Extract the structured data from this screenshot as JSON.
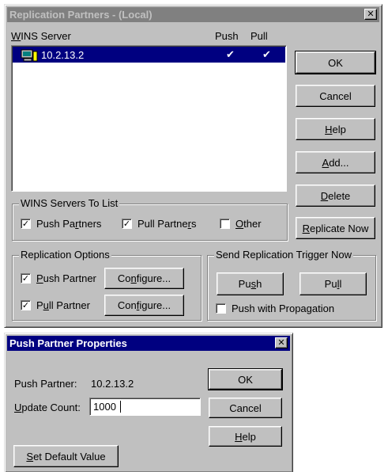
{
  "replication": {
    "title": "Replication Partners - (Local)",
    "close": "✕",
    "list_header": {
      "server": "WINS Server",
      "push": "Push",
      "pull": "Pull"
    },
    "rows": [
      {
        "server": "10.2.13.2",
        "push": "✔",
        "pull": "✔",
        "icon": "server-computer-icon"
      }
    ],
    "buttons": {
      "ok": "OK",
      "cancel": "Cancel",
      "help": "Help",
      "add": "Add...",
      "delete": "Delete",
      "replicate_now": "Replicate Now"
    },
    "servers_to_list": {
      "title": "WINS Servers To List",
      "push_partners": {
        "label": "Push Partners",
        "checked": true
      },
      "pull_partners": {
        "label": "Pull Partners",
        "checked": true
      },
      "other": {
        "label": "Other",
        "checked": false
      }
    },
    "replication_options": {
      "title": "Replication Options",
      "push_partner": {
        "label": "Push Partner",
        "checked": true,
        "configure": "Configure..."
      },
      "pull_partner": {
        "label": "Pull Partner",
        "checked": true,
        "configure": "Configure..."
      }
    },
    "trigger": {
      "title": "Send Replication Trigger Now",
      "push": "Push",
      "pull": "Pull",
      "propagation": {
        "label": "Push with Propagation",
        "checked": false
      }
    }
  },
  "push_props": {
    "title": "Push Partner Properties",
    "close": "✕",
    "partner_label": "Push Partner:",
    "partner_value": "10.2.13.2",
    "update_count_label": "Update Count:",
    "update_count_value": "1000",
    "buttons": {
      "ok": "OK",
      "cancel": "Cancel",
      "help": "Help",
      "set_default": "Set Default Value"
    }
  },
  "colors": {
    "face": "#c0c0c0",
    "active_title": "#000080",
    "inactive_title": "#808080",
    "selection": "#000080"
  }
}
